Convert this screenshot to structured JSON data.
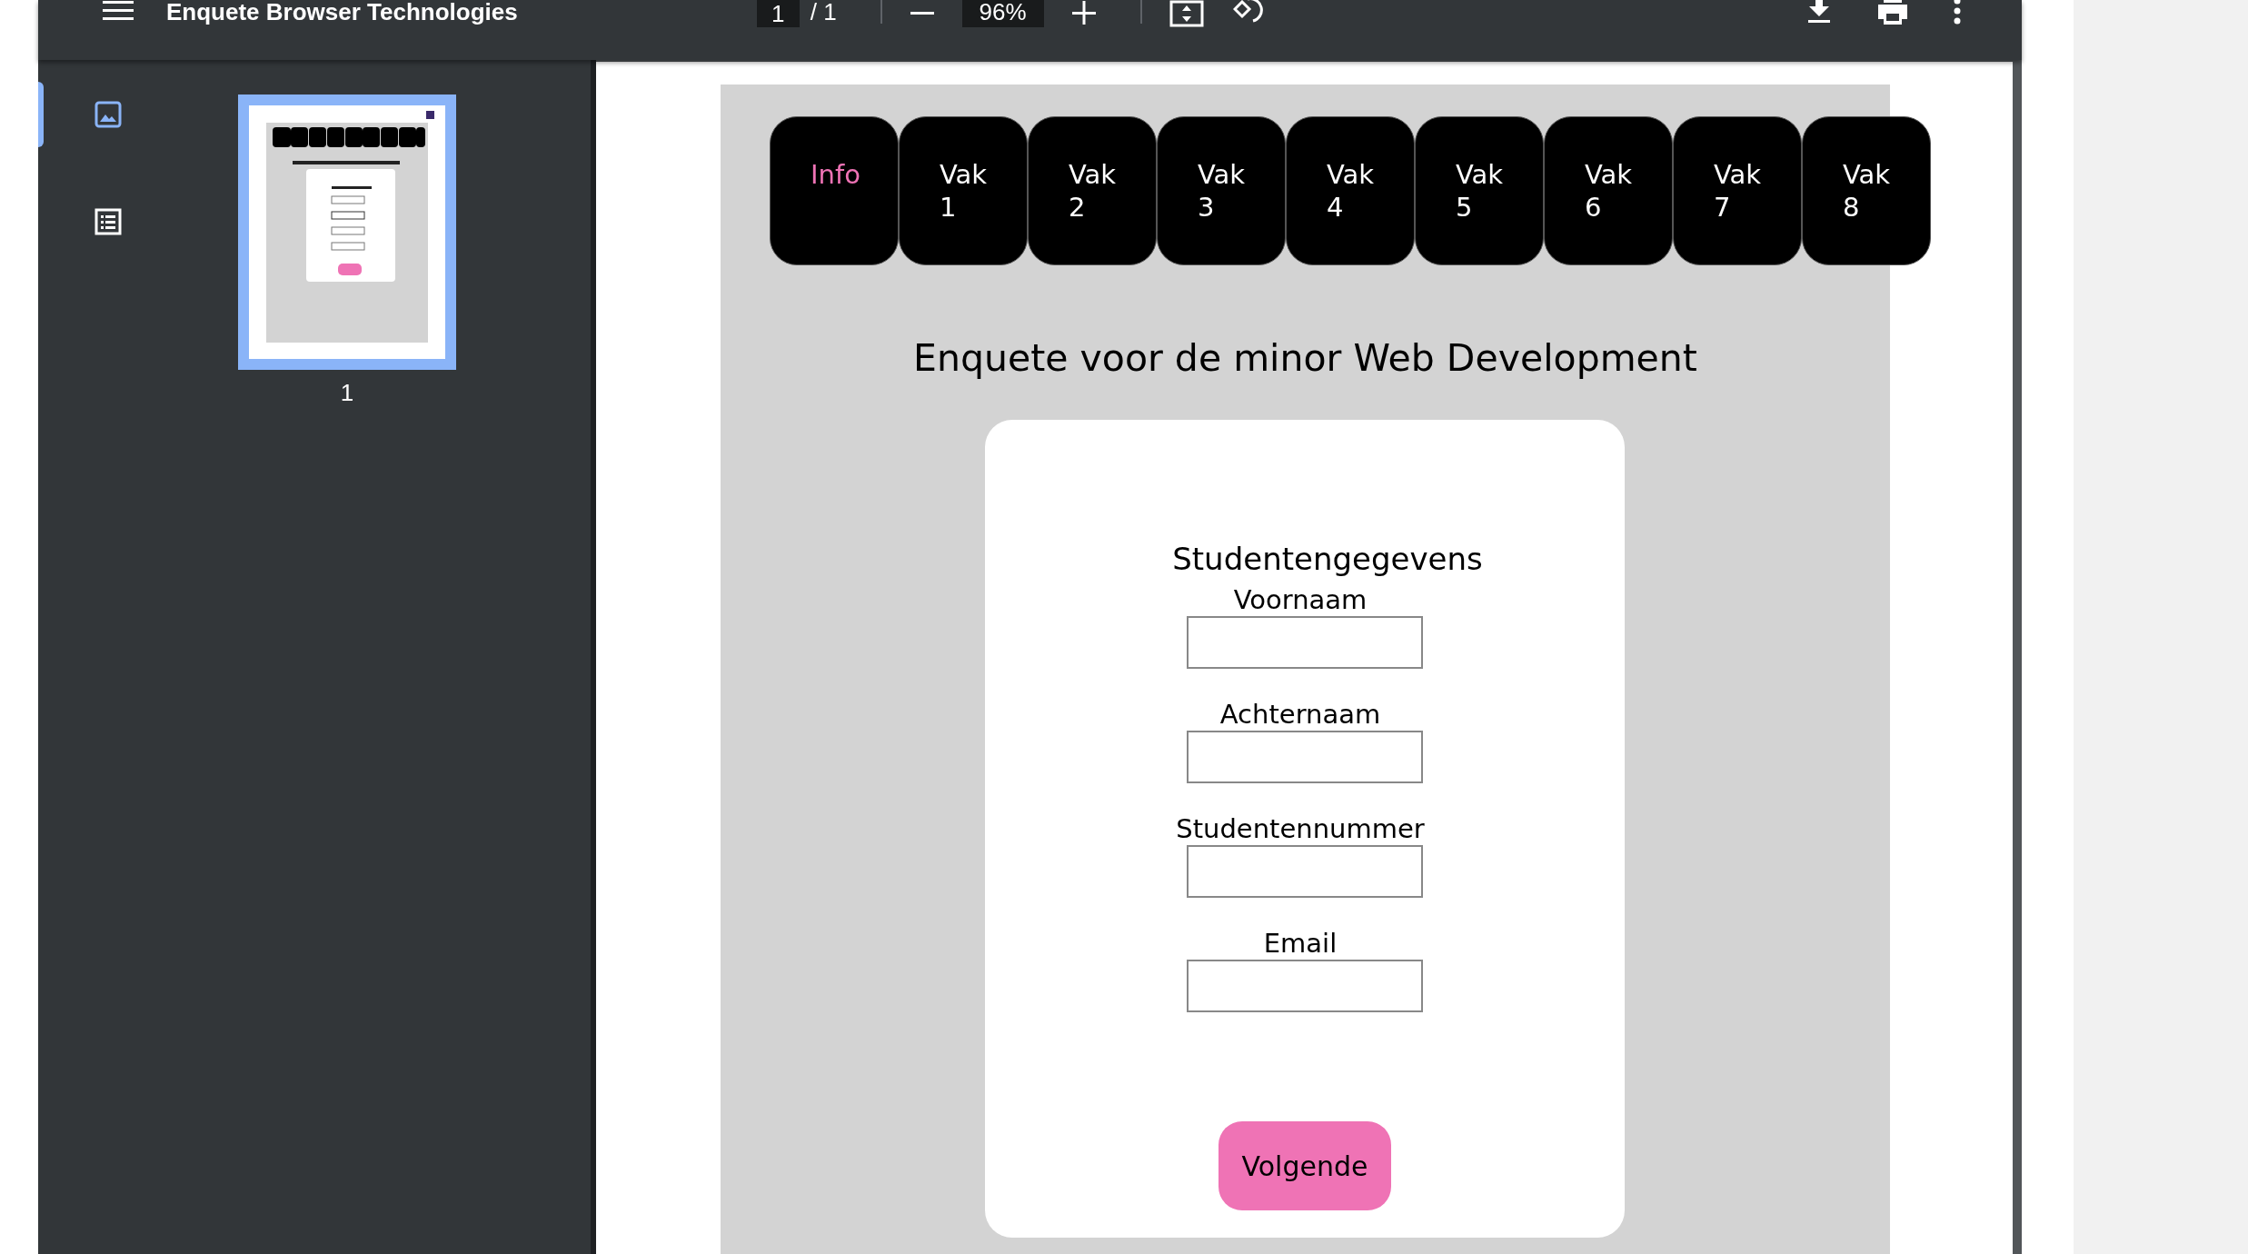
{
  "toolbar": {
    "title": "Enquete Browser Technologies",
    "page_current": "1",
    "page_total": "/ 1",
    "zoom": "96%"
  },
  "sidebar": {
    "items": [
      {
        "kind": "thumbnails",
        "selected": true
      },
      {
        "kind": "outline",
        "selected": false
      }
    ],
    "page_label": "1"
  },
  "nav": [
    {
      "label": "Info",
      "selected": true
    },
    {
      "label": "Vak 1",
      "selected": false
    },
    {
      "label": "Vak 2",
      "selected": false
    },
    {
      "label": "Vak 3",
      "selected": false
    },
    {
      "label": "Vak 4",
      "selected": false
    },
    {
      "label": "Vak 5",
      "selected": false
    },
    {
      "label": "Vak 6",
      "selected": false
    },
    {
      "label": "Vak 7",
      "selected": false
    },
    {
      "label": "Vak 8",
      "selected": false
    }
  ],
  "heading": "Enquete voor de minor Web Development",
  "form": {
    "title": "Studentengegevens",
    "fields": [
      {
        "label": "Voornaam"
      },
      {
        "label": "Achternaam"
      },
      {
        "label": "Studentennummer"
      },
      {
        "label": "Email"
      }
    ],
    "submit": "Volgende"
  }
}
